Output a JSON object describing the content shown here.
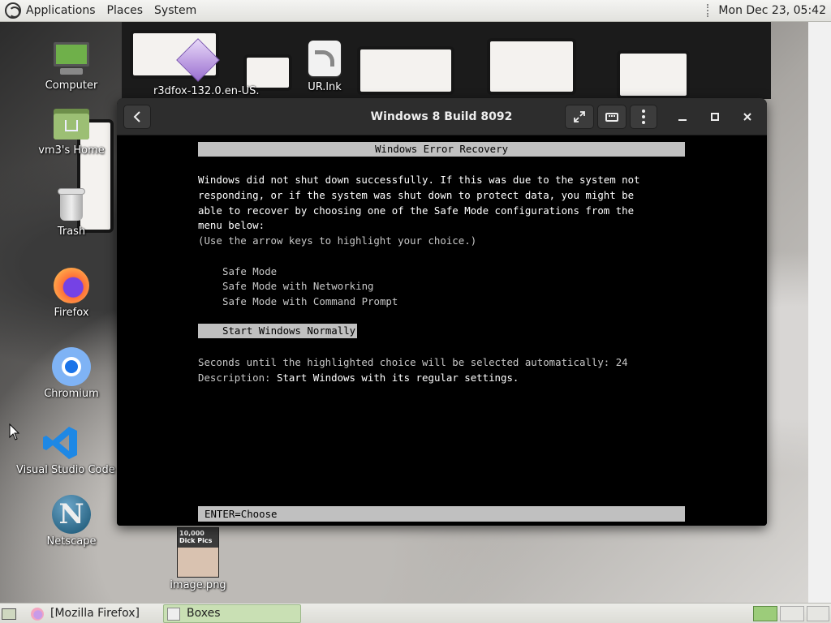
{
  "top_panel": {
    "applications": "Applications",
    "places": "Places",
    "system": "System",
    "clock": "Mon Dec 23, 05:42"
  },
  "desktop_icons": {
    "computer": "Computer",
    "home": "vm3's Home",
    "trash": "Trash",
    "firefox": "Firefox",
    "chromium": "Chromium",
    "vscode": "Visual Studio Code",
    "netscape": "Netscape",
    "r3dfox": "r3dfox-132.0.en-US.",
    "ur_link": "UR.lnk",
    "image": "image.png",
    "image_caption": "10,000\nDick Pics"
  },
  "window": {
    "title": "Windows 8 Build 8092"
  },
  "console": {
    "header": "Windows Error Recovery",
    "message_lines": [
      "Windows did not shut down successfully. If this was due to the system not",
      "responding, or if the system was shut down to protect data, you might be",
      "able to recover by choosing one of the Safe Mode configurations from the",
      "menu below:",
      "(Use the arrow keys to highlight your choice.)"
    ],
    "options": [
      "Safe Mode",
      "Safe Mode with Networking",
      "Safe Mode with Command Prompt"
    ],
    "selected_option": "Start Windows Normally",
    "countdown_text": "Seconds until the highlighted choice will be selected automatically: 24",
    "description_label": "Description: ",
    "description_value": "Start Windows with its regular settings.",
    "footer": "ENTER=Choose"
  },
  "taskbar": {
    "items": [
      "[Mozilla Firefox]",
      "Boxes"
    ]
  },
  "colors": {
    "console_bg": "#000000",
    "console_highlight": "#c0c0c0",
    "panel_bg": "#e8e8e4",
    "active_task": "#c9e0b4",
    "active_workspace": "#9ccc7a"
  }
}
